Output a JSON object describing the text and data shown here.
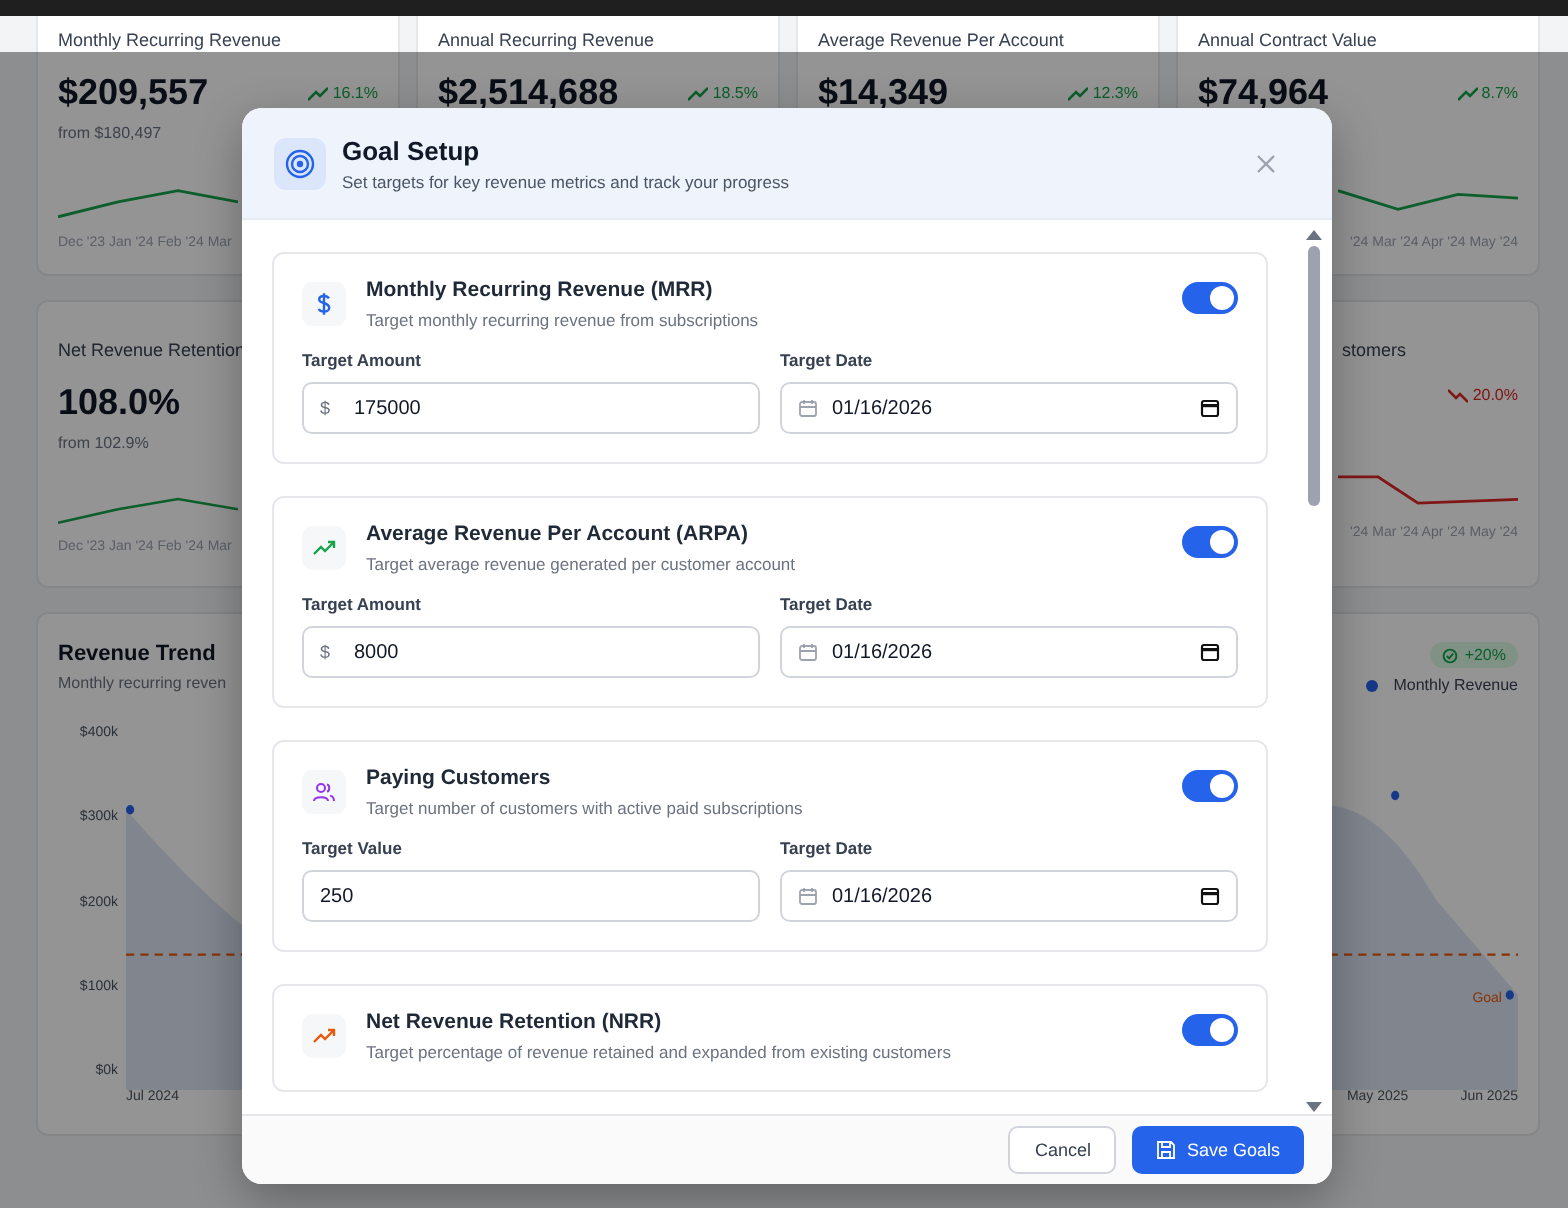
{
  "kpi_cards": [
    {
      "title": "Monthly Recurring Revenue",
      "value": "$209,557",
      "change": "16.1%",
      "declining": false,
      "from": "from $180,497",
      "x_labels": "Dec '23 Jan '24 Feb '24 Mar"
    },
    {
      "title": "Annual Recurring Revenue",
      "value": "$2,514,688",
      "change": "18.5%",
      "declining": false
    },
    {
      "title": "Average Revenue Per Account",
      "value": "$14,349",
      "change": "12.3%",
      "declining": false
    },
    {
      "title": "Annual Contract Value",
      "value": "$74,964",
      "change": "8.7%",
      "declining": false,
      "x_labels": "'24 Mar '24 Apr '24 May '24"
    }
  ],
  "second_row": [
    {
      "title": "Net Revenue Retention",
      "value": "108.0%",
      "from": "from 102.9%",
      "declining": false,
      "x_labels": "Dec '23 Jan '24 Feb '24 Mar"
    },
    {
      "title": "stomers",
      "change": "20.0%",
      "declining": true,
      "x_labels": "'24 Mar '24 Apr '24 May '24"
    }
  ],
  "revenue_trend": {
    "title": "Revenue Trend",
    "subtitle": "Monthly recurring reven",
    "badge": "+20%",
    "legend": "Monthly Revenue",
    "y_ticks": [
      "$400k",
      "$300k",
      "$200k",
      "$100k",
      "$0k"
    ],
    "x_labels": [
      "Jul 2024",
      "May 2025",
      "Jun 2025"
    ],
    "goal_label": "Goal"
  },
  "modal": {
    "title": "Goal Setup",
    "subtitle": "Set targets for key revenue metrics and track your progress",
    "goals": [
      {
        "kind": "currency",
        "title": "Monthly Recurring Revenue (MRR)",
        "description": "Target monthly recurring revenue from subscriptions",
        "enabled": true,
        "value_label": "Target Amount",
        "prefix": "$",
        "value": "175000",
        "date_label": "Target Date",
        "date": "01/16/2026"
      },
      {
        "kind": "growth",
        "title": "Average Revenue Per Account (ARPA)",
        "description": "Target average revenue generated per customer account",
        "enabled": true,
        "value_label": "Target Amount",
        "prefix": "$",
        "value": "8000",
        "date_label": "Target Date",
        "date": "01/16/2026"
      },
      {
        "kind": "people",
        "title": "Paying Customers",
        "description": "Target number of customers with active paid subscriptions",
        "enabled": true,
        "value_label": "Target Value",
        "value": "250",
        "date_label": "Target Date",
        "date": "01/16/2026"
      },
      {
        "kind": "retention",
        "title": "Net Revenue Retention (NRR)",
        "description": "Target percentage of revenue retained and expanded from existing customers",
        "enabled": true
      }
    ],
    "buttons": [
      {
        "label": "Cancel",
        "kind": "secondary"
      },
      {
        "label": "Save Goals",
        "kind": "primary"
      }
    ]
  }
}
